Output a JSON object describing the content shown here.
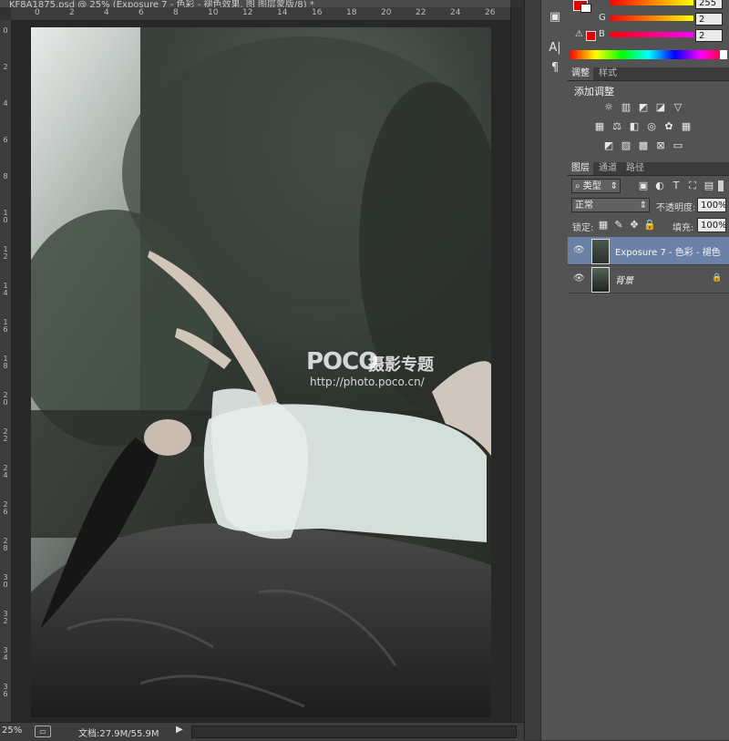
{
  "document": {
    "title": "KF8A1875.psd @ 25% (Exposure 7 - 色彩 - 褪色效果, 图 图层蒙版/8) *",
    "zoom": "25%",
    "doc_info": "文档:27.9M/55.9M",
    "watermark_brand": "POCO",
    "watermark_sub": "摄影专题",
    "watermark_url": "http://photo.poco.cn/",
    "ruler_top": [
      "0",
      "2",
      "4",
      "6",
      "8",
      "10",
      "12",
      "14",
      "16",
      "18",
      "20",
      "22",
      "24",
      "26"
    ],
    "ruler_left": [
      "0",
      "2",
      "4",
      "6",
      "8",
      "10",
      "12",
      "14",
      "16",
      "18",
      "20",
      "22",
      "24",
      "26",
      "28",
      "30",
      "32",
      "34",
      "36"
    ]
  },
  "color_panel": {
    "top_value": "255",
    "g_label": "G",
    "g_value": "2",
    "b_label": "B",
    "b_value": "2"
  },
  "adjustments_panel": {
    "tabs": [
      "调整",
      "样式"
    ],
    "title": "添加调整"
  },
  "layers_panel": {
    "tabs": [
      "图层",
      "通道",
      "路径"
    ],
    "filter_kind": "类型",
    "blend_mode": "正常",
    "opacity_label": "不透明度:",
    "opacity_value": "100%",
    "lock_label": "锁定:",
    "fill_label": "填充:",
    "fill_value": "100%",
    "layers": [
      {
        "name": "Exposure 7 - 色彩 - 褪色 ...",
        "selected": true
      },
      {
        "name": "背景",
        "selected": false
      }
    ]
  },
  "icons": {
    "eye": "eye-icon",
    "lock": "lock-icon",
    "warning": "warning-icon",
    "text_tool": "text-tool-icon",
    "paragraph": "paragraph-icon"
  },
  "colors": {
    "selected_layer": "#6b82a6",
    "foreground_swatch": "#e00000",
    "panel_bg": "#535353"
  }
}
